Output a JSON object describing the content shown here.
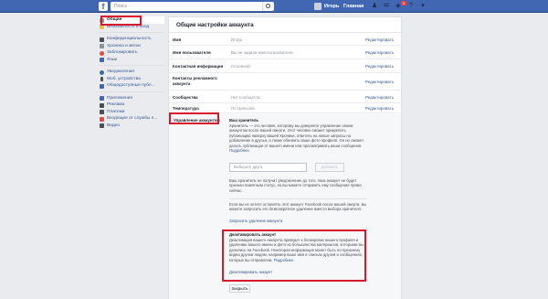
{
  "topbar": {
    "logo": "f",
    "search_placeholder": "Поиск",
    "user": "Игорь",
    "home": "Главная",
    "notification_count": "5",
    "icons": [
      "friends-icon",
      "messages-icon",
      "notifications-icon",
      "help-icon",
      "menu-icon"
    ]
  },
  "sidebar": {
    "groups": [
      [
        {
          "label": "Общие",
          "icon": "gear-icon",
          "active": true
        },
        {
          "label": "Безопасность и вход",
          "icon": "shield-icon"
        }
      ],
      [
        {
          "label": "Конфиденциальность",
          "icon": "lock-icon"
        },
        {
          "label": "Хроника и метки",
          "icon": "timeline-icon"
        },
        {
          "label": "Заблокировать",
          "icon": "block-icon"
        },
        {
          "label": "Язык",
          "icon": "language-icon"
        }
      ],
      [
        {
          "label": "Уведомления",
          "icon": "globe-icon"
        },
        {
          "label": "Моб. устройства",
          "icon": "mobile-icon"
        },
        {
          "label": "Общедоступные публ...",
          "icon": "rss-icon"
        }
      ],
      [
        {
          "label": "Приложения",
          "icon": "apps-icon"
        },
        {
          "label": "Реклама",
          "icon": "ads-icon"
        },
        {
          "label": "Платежи",
          "icon": "payments-icon"
        },
        {
          "label": "Входящие от службы п...",
          "icon": "support-icon"
        },
        {
          "label": "Видео",
          "icon": "video-icon"
        }
      ]
    ]
  },
  "main": {
    "title": "Общие настройки аккаунта",
    "rows": [
      {
        "label": "Имя",
        "value": "Игорь",
        "edit": "Редактировать"
      },
      {
        "label": "Имя пользователя",
        "value": "Вы не задали имя пользователя",
        "edit": "Редактировать"
      },
      {
        "label": "Контактная информация",
        "value": "Основной:",
        "edit": "Редактировать"
      },
      {
        "label": "Контакты рекламного аккаунта",
        "value": "",
        "edit": "Редактировать"
      },
      {
        "label": "Сообщества",
        "value": "Нет сообществ",
        "edit": "Редактировать"
      },
      {
        "label": "Температура",
        "value": "По Цельсию",
        "edit": "Редактировать"
      }
    ],
    "manage": {
      "label": "Управление аккаунтом",
      "heir_title": "Ваш хранитель",
      "heir_text": "Хранитель — это человек, которому вы доверяете управление своим аккаунтом после вашей смерти. Этот человек сможет прикрепить публикацию наверху вашей Хроники, ответить на новые запросы на добавление в друзья, а также обновить ваше фото профиля. Он не сможет делать публикации от вашего имени или просматривать ваши сообщения.",
      "heir_more": "Подробнее.",
      "friend_placeholder": "Выберите друга",
      "add_button": "Добавить",
      "notice_text": "Ваш хранитель не получит уведомление до того, пока аккаунт не будет признан памятным статус, но вы можете отправить ему сообщение прямо сейчас.",
      "delete_text": "Если вы не хотите оставлять этот аккаунт Facebook после вашей смерти, вы можете запросить его безвозвратное удаление вместо выбора хранителя.",
      "delete_link": "Запросить удаление аккаунта",
      "deactivate_title": "Деактивировать аккаунт",
      "deactivate_text": "Деактивация вашего аккаунта приведет к блокировке вашего профиля и удалению вашего имени и фото из большинства материалов, которыми вы делились на Facebook. Некоторая информация может быть по-прежнему видна другим людям, например ваше имя в списках друзей и сообщениях, которые вы отправляли.",
      "deactivate_more": "Подробнее.",
      "deactivate_link": "Деактивировать аккаунт",
      "close_button": "Закрыть"
    }
  }
}
